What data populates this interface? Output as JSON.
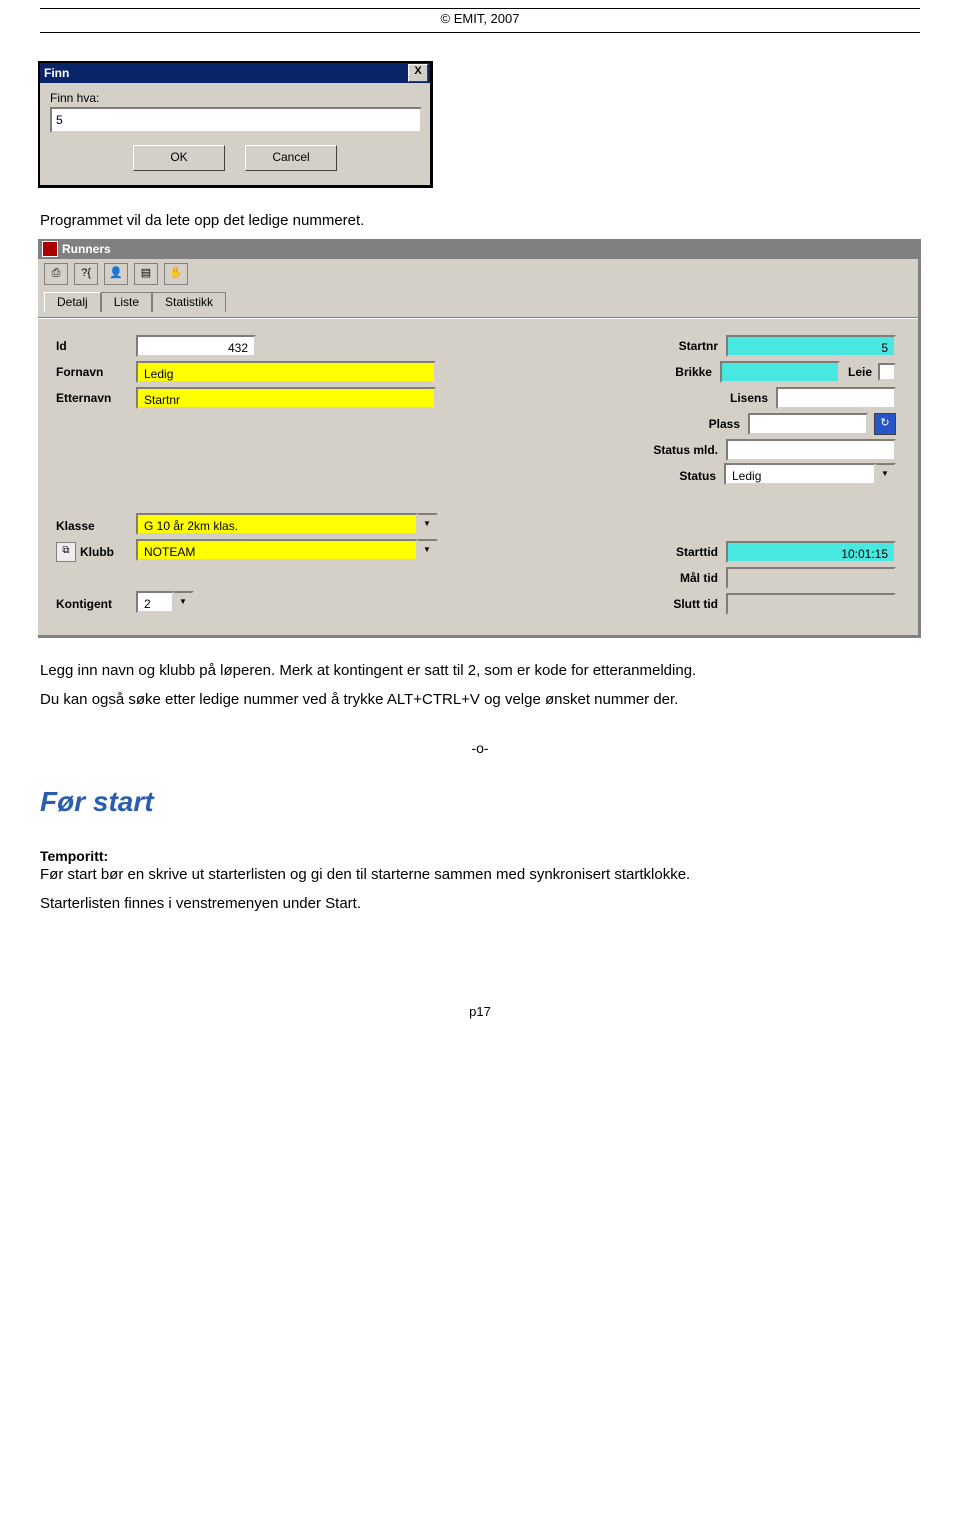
{
  "header": {
    "copyright": "© EMIT, 2007"
  },
  "finn_dialog": {
    "title": "Finn",
    "close": "X",
    "label": "Finn hva:",
    "value": "5",
    "ok": "OK",
    "cancel": "Cancel"
  },
  "text1": "Programmet vil da lete opp det ledige nummeret.",
  "runners": {
    "title": "Runners",
    "tabs": {
      "detalj": "Detalj",
      "liste": "Liste",
      "statistikk": "Statistikk"
    },
    "labels": {
      "id": "Id",
      "fornavn": "Fornavn",
      "etternavn": "Etternavn",
      "startnr": "Startnr",
      "brikke": "Brikke",
      "lisens": "Lisens",
      "plass": "Plass",
      "statusmld": "Status mld.",
      "status": "Status",
      "klasse": "Klasse",
      "klubb": "Klubb",
      "starttid": "Starttid",
      "maltid": "Mål tid",
      "slutttid": "Slutt tid",
      "kontigent": "Kontigent",
      "leie": "Leie"
    },
    "values": {
      "id": "432",
      "fornavn": "Ledig",
      "etternavn": "Startnr",
      "startnr": "5",
      "brikke": "",
      "lisens": "",
      "plass": "",
      "statusmld": "",
      "status": "Ledig",
      "klasse": "G 10 år 2km klas.",
      "klubb": "NOTEAM",
      "starttid": "10:01:15",
      "maltid": "",
      "slutttid": "",
      "kontigent": "2"
    }
  },
  "text2": "Legg inn navn og klubb på løperen. Merk at kontingent er satt til 2, som er kode for etteranmelding.",
  "text3": "Du kan også søke etter ledige nummer ved å trykke ALT+CTRL+V og velge ønsket nummer der.",
  "dash": "-o-",
  "section_heading": "Før start",
  "tempo_label": "Temporitt:",
  "text4": "Før start bør en skrive ut starterlisten og gi den til starterne sammen med synkronisert startklokke.",
  "text5": "Starterlisten finnes i venstremenyen under Start.",
  "footer": "p17"
}
